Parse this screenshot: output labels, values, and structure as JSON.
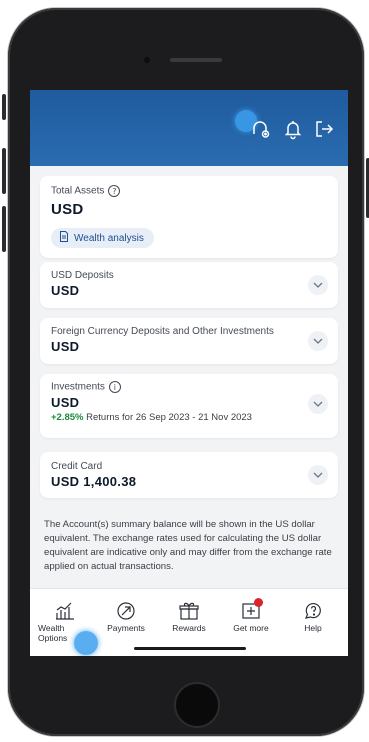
{
  "summary": {
    "total_assets_label": "Total Assets",
    "total_assets_value": "USD",
    "wealth_analysis_label": "Wealth analysis"
  },
  "accounts": [
    {
      "label": "USD Deposits",
      "value": "USD"
    },
    {
      "label": "Foreign Currency Deposits and Other Investments",
      "value": "USD"
    }
  ],
  "investments": {
    "label": "Investments",
    "value": "USD",
    "returns_pct": "+2.85%",
    "returns_text": "Returns for 26 Sep 2023 - 21 Nov 2023"
  },
  "credit_card": {
    "label": "Credit Card",
    "value": "USD 1,400.38"
  },
  "disclaimer": "The Account(s) summary balance will be shown in the US dollar equivalent. The exchange rates used for calculating the US dollar equivalent are indicative only and may differ from the exchange rate applied on actual transactions.",
  "nav": [
    {
      "label": "Wealth Options",
      "icon": "chart-bars-icon"
    },
    {
      "label": "Payments",
      "icon": "payment-arrow-icon"
    },
    {
      "label": "Rewards",
      "icon": "gift-icon"
    },
    {
      "label": "Get more",
      "icon": "add-box-icon",
      "badge": true
    },
    {
      "label": "Help",
      "icon": "help-bubble-icon"
    }
  ],
  "colors": {
    "header": "#2a6cb0",
    "positive": "#1a8a3a",
    "badge": "#d9262c",
    "accent": "#1f4f8f"
  }
}
